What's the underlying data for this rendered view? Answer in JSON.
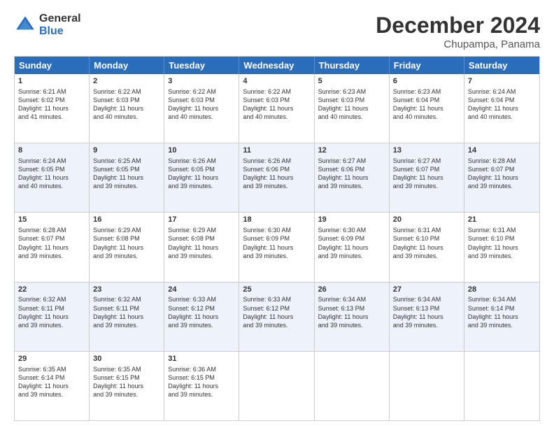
{
  "header": {
    "logo_general": "General",
    "logo_blue": "Blue",
    "month_title": "December 2024",
    "location": "Chupampa, Panama"
  },
  "calendar": {
    "days_of_week": [
      "Sunday",
      "Monday",
      "Tuesday",
      "Wednesday",
      "Thursday",
      "Friday",
      "Saturday"
    ],
    "weeks": [
      [
        {
          "day": "",
          "content": ""
        },
        {
          "day": "2",
          "content": "Sunrise: 6:22 AM\nSunset: 6:03 PM\nDaylight: 11 hours\nand 40 minutes."
        },
        {
          "day": "3",
          "content": "Sunrise: 6:22 AM\nSunset: 6:03 PM\nDaylight: 11 hours\nand 40 minutes."
        },
        {
          "day": "4",
          "content": "Sunrise: 6:22 AM\nSunset: 6:03 PM\nDaylight: 11 hours\nand 40 minutes."
        },
        {
          "day": "5",
          "content": "Sunrise: 6:23 AM\nSunset: 6:03 PM\nDaylight: 11 hours\nand 40 minutes."
        },
        {
          "day": "6",
          "content": "Sunrise: 6:23 AM\nSunset: 6:04 PM\nDaylight: 11 hours\nand 40 minutes."
        },
        {
          "day": "7",
          "content": "Sunrise: 6:24 AM\nSunset: 6:04 PM\nDaylight: 11 hours\nand 40 minutes."
        }
      ],
      [
        {
          "day": "1",
          "content": "Sunrise: 6:21 AM\nSunset: 6:02 PM\nDaylight: 11 hours\nand 41 minutes."
        },
        {
          "day": "",
          "content": ""
        },
        {
          "day": "",
          "content": ""
        },
        {
          "day": "",
          "content": ""
        },
        {
          "day": "",
          "content": ""
        },
        {
          "day": "",
          "content": ""
        },
        {
          "day": "",
          "content": ""
        }
      ],
      [
        {
          "day": "8",
          "content": "Sunrise: 6:24 AM\nSunset: 6:05 PM\nDaylight: 11 hours\nand 40 minutes."
        },
        {
          "day": "9",
          "content": "Sunrise: 6:25 AM\nSunset: 6:05 PM\nDaylight: 11 hours\nand 39 minutes."
        },
        {
          "day": "10",
          "content": "Sunrise: 6:26 AM\nSunset: 6:05 PM\nDaylight: 11 hours\nand 39 minutes."
        },
        {
          "day": "11",
          "content": "Sunrise: 6:26 AM\nSunset: 6:06 PM\nDaylight: 11 hours\nand 39 minutes."
        },
        {
          "day": "12",
          "content": "Sunrise: 6:27 AM\nSunset: 6:06 PM\nDaylight: 11 hours\nand 39 minutes."
        },
        {
          "day": "13",
          "content": "Sunrise: 6:27 AM\nSunset: 6:07 PM\nDaylight: 11 hours\nand 39 minutes."
        },
        {
          "day": "14",
          "content": "Sunrise: 6:28 AM\nSunset: 6:07 PM\nDaylight: 11 hours\nand 39 minutes."
        }
      ],
      [
        {
          "day": "15",
          "content": "Sunrise: 6:28 AM\nSunset: 6:07 PM\nDaylight: 11 hours\nand 39 minutes."
        },
        {
          "day": "16",
          "content": "Sunrise: 6:29 AM\nSunset: 6:08 PM\nDaylight: 11 hours\nand 39 minutes."
        },
        {
          "day": "17",
          "content": "Sunrise: 6:29 AM\nSunset: 6:08 PM\nDaylight: 11 hours\nand 39 minutes."
        },
        {
          "day": "18",
          "content": "Sunrise: 6:30 AM\nSunset: 6:09 PM\nDaylight: 11 hours\nand 39 minutes."
        },
        {
          "day": "19",
          "content": "Sunrise: 6:30 AM\nSunset: 6:09 PM\nDaylight: 11 hours\nand 39 minutes."
        },
        {
          "day": "20",
          "content": "Sunrise: 6:31 AM\nSunset: 6:10 PM\nDaylight: 11 hours\nand 39 minutes."
        },
        {
          "day": "21",
          "content": "Sunrise: 6:31 AM\nSunset: 6:10 PM\nDaylight: 11 hours\nand 39 minutes."
        }
      ],
      [
        {
          "day": "22",
          "content": "Sunrise: 6:32 AM\nSunset: 6:11 PM\nDaylight: 11 hours\nand 39 minutes."
        },
        {
          "day": "23",
          "content": "Sunrise: 6:32 AM\nSunset: 6:11 PM\nDaylight: 11 hours\nand 39 minutes."
        },
        {
          "day": "24",
          "content": "Sunrise: 6:33 AM\nSunset: 6:12 PM\nDaylight: 11 hours\nand 39 minutes."
        },
        {
          "day": "25",
          "content": "Sunrise: 6:33 AM\nSunset: 6:12 PM\nDaylight: 11 hours\nand 39 minutes."
        },
        {
          "day": "26",
          "content": "Sunrise: 6:34 AM\nSunset: 6:13 PM\nDaylight: 11 hours\nand 39 minutes."
        },
        {
          "day": "27",
          "content": "Sunrise: 6:34 AM\nSunset: 6:13 PM\nDaylight: 11 hours\nand 39 minutes."
        },
        {
          "day": "28",
          "content": "Sunrise: 6:34 AM\nSunset: 6:14 PM\nDaylight: 11 hours\nand 39 minutes."
        }
      ],
      [
        {
          "day": "29",
          "content": "Sunrise: 6:35 AM\nSunset: 6:14 PM\nDaylight: 11 hours\nand 39 minutes."
        },
        {
          "day": "30",
          "content": "Sunrise: 6:35 AM\nSunset: 6:15 PM\nDaylight: 11 hours\nand 39 minutes."
        },
        {
          "day": "31",
          "content": "Sunrise: 6:36 AM\nSunset: 6:15 PM\nDaylight: 11 hours\nand 39 minutes."
        },
        {
          "day": "",
          "content": ""
        },
        {
          "day": "",
          "content": ""
        },
        {
          "day": "",
          "content": ""
        },
        {
          "day": "",
          "content": ""
        }
      ]
    ]
  }
}
